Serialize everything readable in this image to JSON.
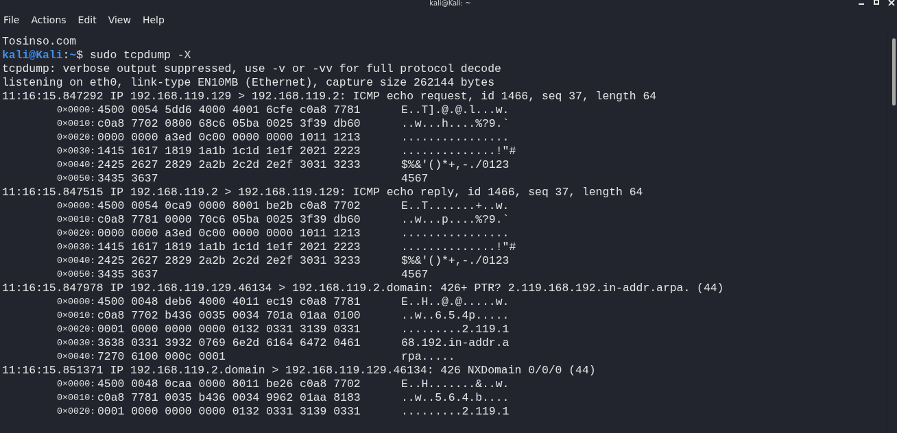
{
  "window": {
    "title": "kali@Kali: ~"
  },
  "menu": [
    "File",
    "Actions",
    "Edit",
    "View",
    "Help"
  ],
  "lines": [
    {
      "kind": "text",
      "text": "Tosinso.com"
    },
    {
      "kind": "prompt",
      "user": "kali@Kali",
      "separator": ":",
      "path": "~",
      "symbol": "$",
      "command": " sudo tcpdump -X"
    },
    {
      "kind": "text",
      "text": "tcpdump: verbose output suppressed, use -v or -vv for full protocol decode"
    },
    {
      "kind": "text",
      "text": "listening on eth0, link-type EN10MB (Ethernet), capture size 262144 bytes"
    },
    {
      "kind": "text",
      "text": "11:16:15.847292 IP 192.168.119.129 > 192.168.119.2: ICMP echo request, id 1466, seq 37, length 64"
    },
    {
      "kind": "hex",
      "offset": "0×0000:",
      "hex": "4500 0054 5dd6 4000 4001 6cfe c0a8 7781",
      "ascii": "E..T].@.@.l...w."
    },
    {
      "kind": "hex",
      "offset": "0×0010:",
      "hex": "c0a8 7702 0800 68c6 05ba 0025 3f39 db60",
      "ascii": "..w...h....%?9.`"
    },
    {
      "kind": "hex",
      "offset": "0×0020:",
      "hex": "0000 0000 a3ed 0c00 0000 0000 1011 1213",
      "ascii": "................"
    },
    {
      "kind": "hex",
      "offset": "0×0030:",
      "hex": "1415 1617 1819 1a1b 1c1d 1e1f 2021 2223",
      "ascii": "..............!\"#"
    },
    {
      "kind": "hex",
      "offset": "0×0040:",
      "hex": "2425 2627 2829 2a2b 2c2d 2e2f 3031 3233",
      "ascii": "$%&'()*+,-./0123"
    },
    {
      "kind": "hex",
      "offset": "0×0050:",
      "hex": "3435 3637",
      "ascii": "4567"
    },
    {
      "kind": "text",
      "text": "11:16:15.847515 IP 192.168.119.2 > 192.168.119.129: ICMP echo reply, id 1466, seq 37, length 64"
    },
    {
      "kind": "hex",
      "offset": "0×0000:",
      "hex": "4500 0054 0ca9 0000 8001 be2b c0a8 7702",
      "ascii": "E..T.......+..w."
    },
    {
      "kind": "hex",
      "offset": "0×0010:",
      "hex": "c0a8 7781 0000 70c6 05ba 0025 3f39 db60",
      "ascii": "..w...p....%?9.`"
    },
    {
      "kind": "hex",
      "offset": "0×0020:",
      "hex": "0000 0000 a3ed 0c00 0000 0000 1011 1213",
      "ascii": "................"
    },
    {
      "kind": "hex",
      "offset": "0×0030:",
      "hex": "1415 1617 1819 1a1b 1c1d 1e1f 2021 2223",
      "ascii": "..............!\"#"
    },
    {
      "kind": "hex",
      "offset": "0×0040:",
      "hex": "2425 2627 2829 2a2b 2c2d 2e2f 3031 3233",
      "ascii": "$%&'()*+,-./0123"
    },
    {
      "kind": "hex",
      "offset": "0×0050:",
      "hex": "3435 3637",
      "ascii": "4567"
    },
    {
      "kind": "text",
      "text": "11:16:15.847978 IP 192.168.119.129.46134 > 192.168.119.2.domain: 426+ PTR? 2.119.168.192.in-addr.arpa. (44)"
    },
    {
      "kind": "hex",
      "offset": "0×0000:",
      "hex": "4500 0048 deb6 4000 4011 ec19 c0a8 7781",
      "ascii": "E..H..@.@.....w."
    },
    {
      "kind": "hex",
      "offset": "0×0010:",
      "hex": "c0a8 7702 b436 0035 0034 701a 01aa 0100",
      "ascii": "..w..6.5.4p....."
    },
    {
      "kind": "hex",
      "offset": "0×0020:",
      "hex": "0001 0000 0000 0000 0132 0331 3139 0331",
      "ascii": ".........2.119.1"
    },
    {
      "kind": "hex",
      "offset": "0×0030:",
      "hex": "3638 0331 3932 0769 6e2d 6164 6472 0461",
      "ascii": "68.192.in-addr.a"
    },
    {
      "kind": "hex",
      "offset": "0×0040:",
      "hex": "7270 6100 000c 0001",
      "ascii": "rpa....."
    },
    {
      "kind": "text",
      "text": "11:16:15.851371 IP 192.168.119.2.domain > 192.168.119.129.46134: 426 NXDomain 0/0/0 (44)"
    },
    {
      "kind": "hex",
      "offset": "0×0000:",
      "hex": "4500 0048 0caa 0000 8011 be26 c0a8 7702",
      "ascii": "E..H.......&..w."
    },
    {
      "kind": "hex",
      "offset": "0×0010:",
      "hex": "c0a8 7781 0035 b436 0034 9962 01aa 8183",
      "ascii": "..w..5.6.4.b...."
    },
    {
      "kind": "hex",
      "offset": "0×0020:",
      "hex": "0001 0000 0000 0000 0132 0331 3139 0331",
      "ascii": ".........2.119.1"
    }
  ]
}
